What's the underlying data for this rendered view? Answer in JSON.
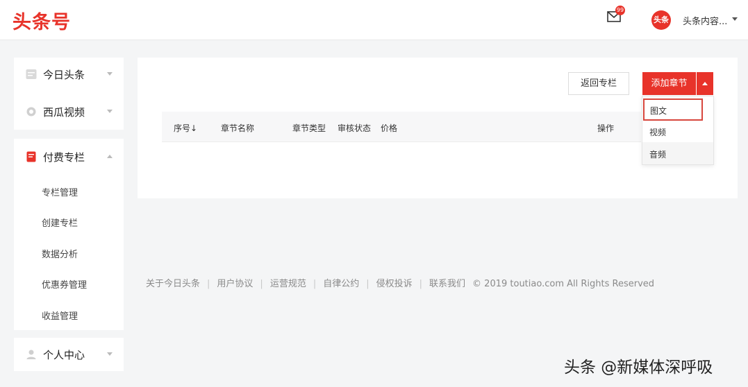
{
  "header": {
    "logo": "头条号",
    "mail_badge": "99",
    "avatar_text": "头条",
    "username": "头条内容..."
  },
  "sidebar": {
    "platforms": [
      {
        "label": "今日头条",
        "icon": "toutiao-app-icon"
      },
      {
        "label": "西瓜视频",
        "icon": "xigua-video-icon"
      }
    ],
    "paid_column": {
      "label": "付费专栏",
      "icon": "paid-column-icon",
      "items": [
        "专栏管理",
        "创建专栏",
        "数据分析",
        "优惠券管理",
        "收益管理"
      ]
    },
    "personal": {
      "label": "个人中心",
      "icon": "user-icon"
    }
  },
  "main": {
    "back_button": "返回专栏",
    "add_button": "添加章节",
    "table_headers": [
      "序号↓",
      "章节名称",
      "章节类型",
      "审核状态",
      "价格",
      "操作"
    ],
    "dropdown_options": [
      "图文",
      "视频",
      "音频"
    ]
  },
  "footer": {
    "links": [
      "关于今日头条",
      "用户协议",
      "运营规范",
      "自律公约",
      "侵权投诉",
      "联系我们"
    ],
    "separator": "|",
    "copyright": "© 2019 toutiao.com All Rights Reserved"
  },
  "watermark": "头条 @新媒体深呼吸",
  "colors": {
    "brand_red": "#e8332a"
  }
}
